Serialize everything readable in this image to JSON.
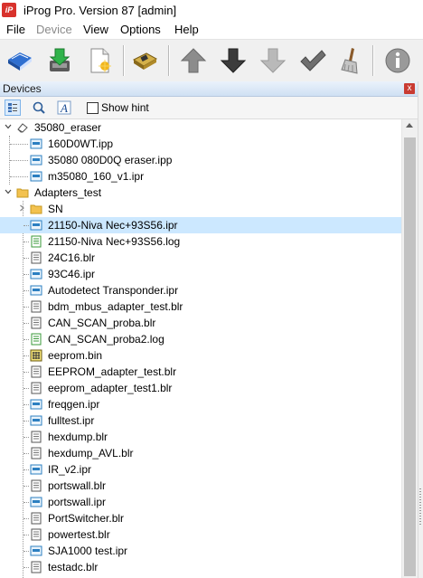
{
  "window": {
    "title": "iProg Pro. Version 87 [admin]",
    "app_icon_text": "iP"
  },
  "menu": [
    {
      "label": "File",
      "enabled": true
    },
    {
      "label": "Device",
      "enabled": false
    },
    {
      "label": "View",
      "enabled": true
    },
    {
      "label": "Options",
      "enabled": true
    },
    {
      "label": "Help",
      "enabled": true
    }
  ],
  "toolbar": [
    "open-book-icon",
    "save-download-icon",
    "new-file-icon",
    "device-chip-icon",
    "arrow-up-icon",
    "arrow-down-icon",
    "arrow-down-disabled-icon",
    "checkmark-icon",
    "broom-icon",
    "info-icon"
  ],
  "panel": {
    "title": "Devices",
    "close": "x"
  },
  "hint": {
    "label": "Show hint",
    "checked": false,
    "buttons": [
      "list-view-icon",
      "search-icon",
      "font-icon"
    ]
  },
  "colors": {
    "selection": "#cce8ff",
    "folder": "#f3c24f",
    "ipr_blue": "#2c7fc1",
    "log_green": "#3a9a3a"
  },
  "tree": [
    {
      "name": "35080_eraser",
      "icon": "eraser-icon",
      "level": 0,
      "toggle": "expanded"
    },
    {
      "name": "160D0WT.ipp",
      "icon": "ipp-file-icon",
      "level": 1
    },
    {
      "name": "35080 080D0Q eraser.ipp",
      "icon": "ipp-file-icon",
      "level": 1
    },
    {
      "name": "m35080_160_v1.ipr",
      "icon": "ipr-file-icon",
      "level": 1
    },
    {
      "name": "Adapters_test",
      "icon": "folder-icon",
      "level": 0,
      "toggle": "expanded"
    },
    {
      "name": "SN",
      "icon": "folder-icon",
      "level": 1,
      "toggle": "collapsed"
    },
    {
      "name": "21150-Niva Nec+93S56.ipr",
      "icon": "ipr-file-icon",
      "level": 1,
      "selected": true
    },
    {
      "name": "21150-Niva Nec+93S56.log",
      "icon": "log-file-icon",
      "level": 1
    },
    {
      "name": "24C16.blr",
      "icon": "blr-file-icon",
      "level": 1
    },
    {
      "name": "93C46.ipr",
      "icon": "ipr-file-icon",
      "level": 1
    },
    {
      "name": "Autodetect Transponder.ipr",
      "icon": "ipr-file-icon",
      "level": 1
    },
    {
      "name": "bdm_mbus_adapter_test.blr",
      "icon": "blr-file-icon",
      "level": 1
    },
    {
      "name": "CAN_SCAN_proba.blr",
      "icon": "blr-file-icon",
      "level": 1
    },
    {
      "name": "CAN_SCAN_proba2.log",
      "icon": "log-file-icon",
      "level": 1
    },
    {
      "name": "eeprom.bin",
      "icon": "bin-file-icon",
      "level": 1
    },
    {
      "name": "EEPROM_adapter_test.blr",
      "icon": "blr-file-icon",
      "level": 1
    },
    {
      "name": "eeprom_adapter_test1.blr",
      "icon": "blr-file-icon",
      "level": 1
    },
    {
      "name": "freqgen.ipr",
      "icon": "ipr-file-icon",
      "level": 1
    },
    {
      "name": "fulltest.ipr",
      "icon": "ipr-file-icon",
      "level": 1
    },
    {
      "name": "hexdump.blr",
      "icon": "blr-file-icon",
      "level": 1
    },
    {
      "name": "hexdump_AVL.blr",
      "icon": "blr-file-icon",
      "level": 1
    },
    {
      "name": "IR_v2.ipr",
      "icon": "ipr-file-icon",
      "level": 1
    },
    {
      "name": "portswall.blr",
      "icon": "blr-file-icon",
      "level": 1
    },
    {
      "name": "portswall.ipr",
      "icon": "ipr-file-icon",
      "level": 1
    },
    {
      "name": "PortSwitcher.blr",
      "icon": "blr-file-icon",
      "level": 1
    },
    {
      "name": "powertest.blr",
      "icon": "blr-file-icon",
      "level": 1
    },
    {
      "name": "SJA1000 test.ipr",
      "icon": "ipr-file-icon",
      "level": 1
    },
    {
      "name": "testadc.blr",
      "icon": "blr-file-icon",
      "level": 1
    }
  ]
}
